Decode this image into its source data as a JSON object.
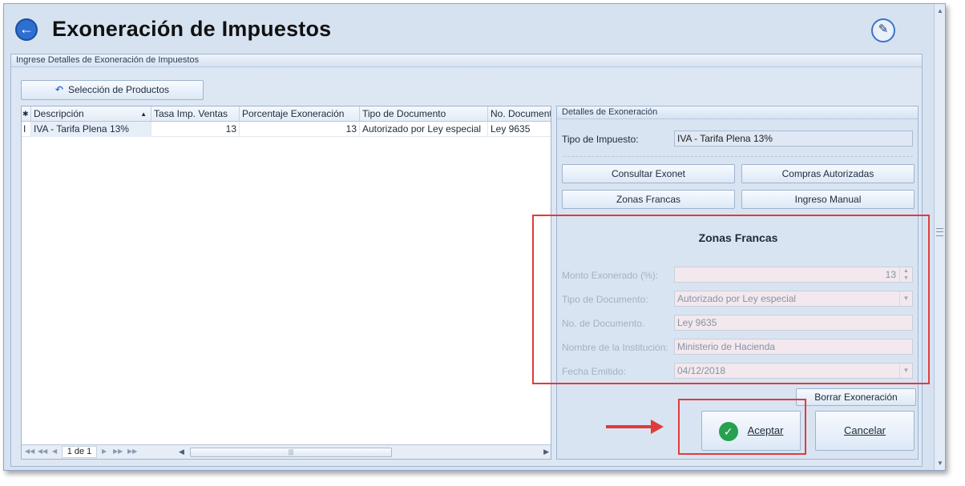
{
  "header": {
    "title": "Exoneración de Impuestos",
    "back_icon": "arrow-left-circle",
    "edit_icon": "edit-pencil"
  },
  "main_group": {
    "title": "Ingrese Detalles de Exoneración de Impuestos",
    "select_products_label": "Selección de Productos"
  },
  "grid": {
    "columns": [
      "Descripción",
      "Tasa Imp. Ventas",
      "Porcentaje Exoneración",
      "Tipo de Documento",
      "No. Document"
    ],
    "rows": [
      [
        "IVA - Tarifa Plena 13%",
        "13",
        "13",
        "Autorizado por Ley especial",
        "Ley 9635"
      ]
    ],
    "row_marker": "I",
    "header_marker": "✱",
    "pager": "1 de 1"
  },
  "details": {
    "title": "Detalles de Exoneración",
    "tax_type_label": "Tipo de Impuesto:",
    "tax_type_value": "IVA - Tarifa Plena 13%",
    "btn_consultar": "Consultar Exonet",
    "btn_compras": "Compras Autorizadas",
    "btn_zonas": "Zonas Francas",
    "btn_ingreso": "Ingreso Manual",
    "zf_title": "Zonas Francas",
    "monto_label": "Monto Exonerado (%):",
    "monto_value": "13",
    "tipo_doc_label": "Tipo de Documento:",
    "tipo_doc_value": "Autorizado por Ley especial",
    "no_doc_label": "No. de Documento.",
    "no_doc_value": "Ley 9635",
    "institucion_label": "Nombre de la Institución:",
    "institucion_value": "Ministerio de Hacienda",
    "fecha_label": "Fecha Emitido:",
    "fecha_value": "04/12/2018",
    "btn_borrar": "Borrar Exoneración",
    "btn_aceptar": "Aceptar",
    "btn_cancelar": "Cancelar"
  },
  "colors": {
    "highlight": "#e03b3b",
    "accept": "#27a050",
    "accent": "#2f6fd1"
  }
}
